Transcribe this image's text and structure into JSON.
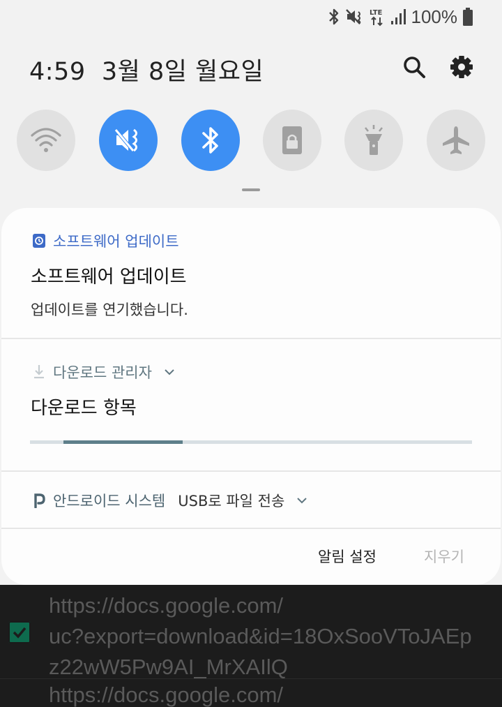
{
  "status_bar": {
    "battery_percent": "100%"
  },
  "header": {
    "time": "4:59",
    "date": "3월 8일 월요일"
  },
  "quick_toggles": [
    {
      "name": "wifi",
      "state": "off"
    },
    {
      "name": "mute",
      "state": "on"
    },
    {
      "name": "bluetooth",
      "state": "on"
    },
    {
      "name": "rotation-lock",
      "state": "off"
    },
    {
      "name": "flashlight",
      "state": "off"
    },
    {
      "name": "airplane-mode",
      "state": "off"
    }
  ],
  "notifications": {
    "software_update": {
      "app": "소프트웨어 업데이트",
      "title": "소프트웨어 업데이트",
      "text": "업데이트를 연기했습니다.",
      "app_color": "#3d6ac7"
    },
    "download_manager": {
      "app": "다운로드 관리자",
      "title": "다운로드 항목",
      "progress_start": 0.075,
      "progress_end": 0.345,
      "app_color": "#5f7680"
    },
    "android_system": {
      "app": "안드로이드 시스템",
      "detail": "USB로 파일 전송",
      "app_color": "#4d6470"
    },
    "footer": {
      "settings_label": "알림 설정",
      "clear_label": "지우기"
    }
  },
  "background_app": {
    "row1_line1": "https://docs.google.com/",
    "row1_line2": "uc?export=download&id=18OxSooVToJAEp",
    "row1_line3": "z22wW5Pw9AI_MrXAIlQ",
    "row2_line1": "https://docs.google.com/"
  }
}
